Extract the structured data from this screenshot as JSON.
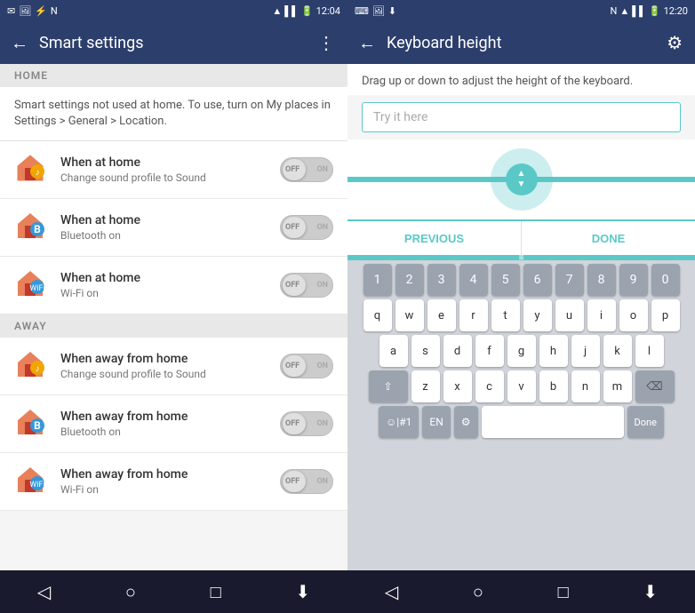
{
  "leftPanel": {
    "statusBar": {
      "time": "12:04",
      "icons": [
        "msg",
        "img",
        "nfc",
        "wifi",
        "signal",
        "battery"
      ]
    },
    "topBar": {
      "title": "Smart settings",
      "backIcon": "←",
      "menuIcon": "⋮"
    },
    "sections": [
      {
        "id": "home",
        "header": "HOME",
        "infoText": "Smart settings not used at home. To use, turn on My places in Settings > General > Location.",
        "items": [
          {
            "title": "When at home",
            "subtitle": "Change sound profile to Sound",
            "type": "sound",
            "toggleState": "off"
          },
          {
            "title": "When at home",
            "subtitle": "Bluetooth on",
            "type": "bluetooth",
            "toggleState": "off"
          },
          {
            "title": "When at home",
            "subtitle": "Wi-Fi on",
            "type": "wifi",
            "toggleState": "off"
          }
        ]
      },
      {
        "id": "away",
        "header": "AWAY",
        "items": [
          {
            "title": "When away from home",
            "subtitle": "Change sound profile to Sound",
            "type": "sound",
            "toggleState": "off"
          },
          {
            "title": "When away from home",
            "subtitle": "Bluetooth on",
            "type": "bluetooth",
            "toggleState": "off"
          },
          {
            "title": "When away from home",
            "subtitle": "Wi-Fi on",
            "type": "wifi",
            "toggleState": "off"
          }
        ]
      }
    ],
    "bottomNav": {
      "back": "◁",
      "home": "○",
      "recents": "□",
      "download": "⬇"
    }
  },
  "rightPanel": {
    "statusBar": {
      "time": "12:20",
      "icons": [
        "keyboard",
        "img",
        "download",
        "nfc",
        "wifi",
        "signal",
        "battery"
      ]
    },
    "topBar": {
      "title": "Keyboard height",
      "backIcon": "←",
      "settingsIcon": "⚙"
    },
    "instructions": "Drag up or down to adjust the height of the keyboard.",
    "inputPlaceholder": "Try it here",
    "actions": {
      "previous": "PREVIOUS",
      "done": "DONE"
    },
    "keyboard": {
      "numbers": [
        "1",
        "2",
        "3",
        "4",
        "5",
        "6",
        "7",
        "8",
        "9",
        "0"
      ],
      "row1": [
        "q",
        "w",
        "e",
        "r",
        "t",
        "y",
        "u",
        "i",
        "o",
        "p"
      ],
      "row2": [
        "a",
        "s",
        "d",
        "f",
        "g",
        "h",
        "j",
        "k",
        "l"
      ],
      "row3": [
        "z",
        "x",
        "c",
        "v",
        "b",
        "n",
        "m"
      ],
      "bottomRow": {
        "emoji": "☺|#1",
        "lang": "EN",
        "settings": "⚙",
        "space": "",
        "done": "Done"
      }
    },
    "bottomNav": {
      "back": "◁",
      "home": "○",
      "recents": "□",
      "download": "⬇"
    }
  }
}
